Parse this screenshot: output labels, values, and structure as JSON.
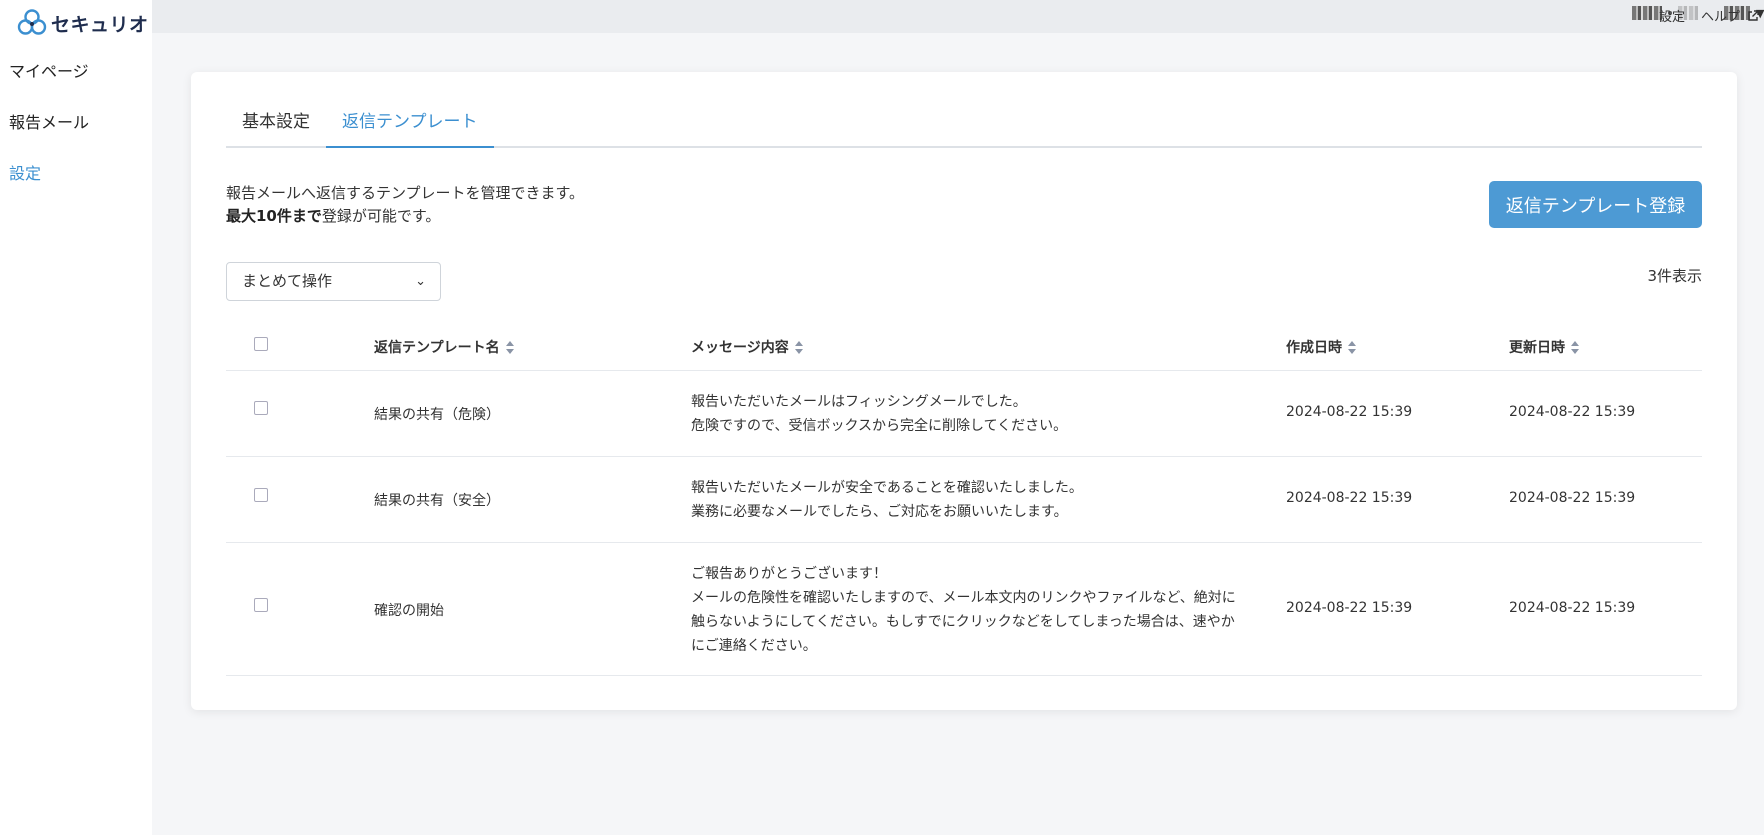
{
  "app": {
    "logo_text": "セキュリオ"
  },
  "sidebar": {
    "items": [
      {
        "label": "マイページ"
      },
      {
        "label": "報告メール"
      },
      {
        "label": "設定"
      }
    ]
  },
  "topbar": {
    "settings_label": "設定",
    "help_label": "ヘルプ"
  },
  "tabs": [
    {
      "label": "基本設定"
    },
    {
      "label": "返信テンプレート"
    }
  ],
  "description": {
    "line1": "報告メールへ返信するテンプレートを管理できます。",
    "line2_bold": "最大10件まで",
    "line2_rest": "登録が可能です。"
  },
  "register_button": "返信テンプレート登録",
  "bulk_action": {
    "value": "まとめて操作"
  },
  "count_label": "3件表示",
  "table": {
    "headers": {
      "name": "返信テンプレート名",
      "message": "メッセージ内容",
      "created": "作成日時",
      "updated": "更新日時"
    },
    "rows": [
      {
        "name": "結果の共有（危険）",
        "message": [
          "報告いただいたメールはフィッシングメールでした。",
          "危険ですので、受信ボックスから完全に削除してください。"
        ],
        "created": "2024-08-22 15:39",
        "updated": "2024-08-22 15:39"
      },
      {
        "name": "結果の共有（安全）",
        "message": [
          "報告いただいたメールが安全であることを確認いたしました。",
          "業務に必要なメールでしたら、ご対応をお願いいたします。"
        ],
        "created": "2024-08-22 15:39",
        "updated": "2024-08-22 15:39"
      },
      {
        "name": "確認の開始",
        "message": [
          "ご報告ありがとうございます！",
          "メールの危険性を確認いたしますので、メール本文内のリンクやファイルなど、絶対に",
          "触らないようにしてください。もしすでにクリックなどをしてしまった場合は、速やか",
          "にご連絡ください。"
        ],
        "created": "2024-08-22 15:39",
        "updated": "2024-08-22 15:39"
      }
    ]
  },
  "colors": {
    "accent": "#3b8fd0",
    "button": "#4d9ad4",
    "background": "#f5f6f8"
  }
}
